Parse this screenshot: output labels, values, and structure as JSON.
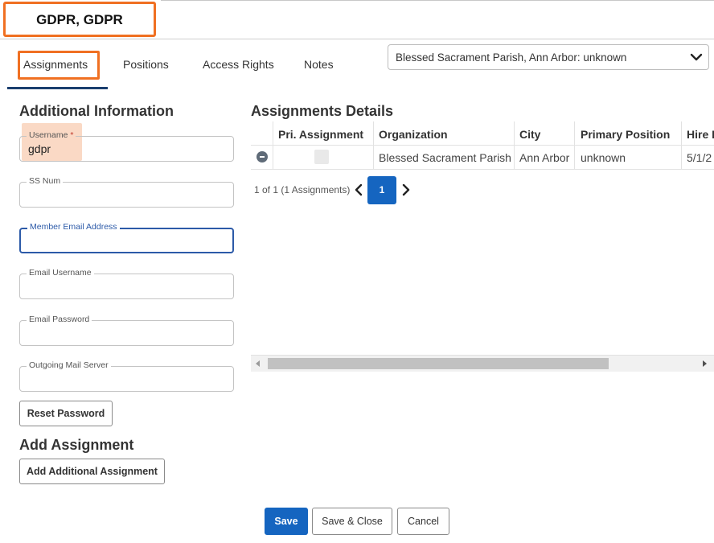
{
  "header": {
    "title": "GDPR, GDPR"
  },
  "tabs": [
    {
      "label": "Assignments",
      "active": true
    },
    {
      "label": "Positions"
    },
    {
      "label": "Access Rights"
    },
    {
      "label": "Notes"
    }
  ],
  "assignment_select": {
    "value": "Blessed Sacrament Parish, Ann Arbor: unknown"
  },
  "additional_info": {
    "title": "Additional Information",
    "fields": {
      "username": {
        "label": "Username",
        "required_mark": "*",
        "value": "gdpr"
      },
      "ss_num": {
        "label": "SS Num",
        "value": ""
      },
      "member_email": {
        "label": "Member Email Address",
        "value": ""
      },
      "email_username": {
        "label": "Email Username",
        "value": ""
      },
      "email_password": {
        "label": "Email Password",
        "value": ""
      },
      "outgoing_mail_server": {
        "label": "Outgoing Mail Server",
        "value": ""
      }
    },
    "reset_password_label": "Reset Password"
  },
  "add_assignment": {
    "title": "Add Assignment",
    "button_label": "Add Additional Assignment"
  },
  "assignments_details": {
    "title": "Assignments Details",
    "columns": [
      "Pri. Assignment",
      "Organization",
      "City",
      "Primary Position",
      "Hire I"
    ],
    "rows": [
      {
        "organization": "Blessed Sacrament Parish",
        "city": "Ann Arbor",
        "primary_position": "unknown",
        "hire": "5/1/2"
      }
    ]
  },
  "pager": {
    "summary": "1 of 1 (1 Assignments)",
    "current_page": "1"
  },
  "footer": {
    "save": "Save",
    "save_close": "Save & Close",
    "cancel": "Cancel"
  },
  "colors": {
    "accent_orange": "#f07022",
    "primary_blue": "#1565c0",
    "focus_blue": "#2c5aa8",
    "highlight": "#fad9c5"
  }
}
